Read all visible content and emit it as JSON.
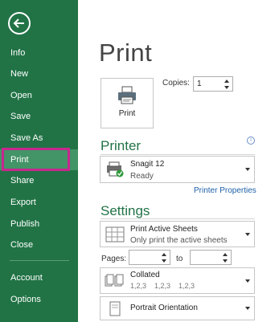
{
  "sidebar": {
    "items": [
      {
        "label": "Info"
      },
      {
        "label": "New"
      },
      {
        "label": "Open"
      },
      {
        "label": "Save"
      },
      {
        "label": "Save As"
      },
      {
        "label": "Print"
      },
      {
        "label": "Share"
      },
      {
        "label": "Export"
      },
      {
        "label": "Publish"
      },
      {
        "label": "Close"
      },
      {
        "label": "Account"
      },
      {
        "label": "Options"
      }
    ],
    "active": "Print"
  },
  "main": {
    "title": "Print",
    "print_button_label": "Print",
    "copies_label": "Copies:",
    "copies_value": "1",
    "printer_heading": "Printer",
    "printer_name": "Snagit 12",
    "printer_status": "Ready",
    "printer_properties_link": "Printer Properties",
    "settings_heading": "Settings",
    "print_what_title": "Print Active Sheets",
    "print_what_sub": "Only print the active sheets",
    "pages_label": "Pages:",
    "to_label": "to",
    "collated_title": "Collated",
    "collated_sub": "1,2,3    1,2,3    1,2,3",
    "orientation_title": "Portrait Orientation"
  },
  "colors": {
    "sidebar_bg": "#217346",
    "active_item_bg": "#439467",
    "highlight_border": "#c8278e",
    "heading_green": "#217346",
    "link_blue": "#1e5fa8"
  }
}
